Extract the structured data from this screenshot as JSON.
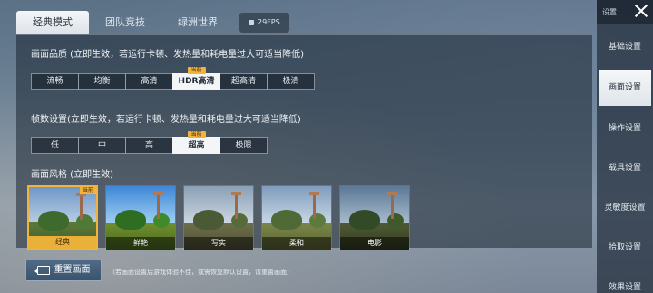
{
  "tabs": [
    {
      "label": "经典模式",
      "active": true
    },
    {
      "label": "团队竞技",
      "active": false
    },
    {
      "label": "绿洲世界",
      "active": false
    }
  ],
  "fps_label": "29FPS",
  "quality": {
    "title": "画面品质 (立即生效，若运行卡顿、发热量和耗电量过大可适当降低)",
    "options": [
      "流畅",
      "均衡",
      "高清",
      "HDR高清",
      "超高清",
      "极清"
    ],
    "selected": "HDR高清",
    "current_tag": "当前"
  },
  "framerate": {
    "title": "帧数设置(立即生效，若运行卡顿、发热量和耗电量过大可适当降低)",
    "options": [
      "低",
      "中",
      "高",
      "超高",
      "极限"
    ],
    "selected": "超高",
    "current_tag": "当前"
  },
  "style": {
    "title": "画面风格 (立即生效)",
    "options": [
      "经典",
      "鲜艳",
      "写实",
      "柔和",
      "电影"
    ],
    "selected": "经典",
    "current_tag": "当前"
  },
  "reset": {
    "label": "重置画面",
    "hint": "（若画面设置后游戏体验不佳，或需恢复默认设置，请重置画面）"
  },
  "sidebar": {
    "title": "设置",
    "items": [
      "基础设置",
      "画面设置",
      "操作设置",
      "载具设置",
      "灵敏度设置",
      "拾取设置",
      "效果设置"
    ],
    "active": "画面设置"
  },
  "colors": {
    "accent": "#f2b33d",
    "selected_bg": "#f3f5f7"
  }
}
